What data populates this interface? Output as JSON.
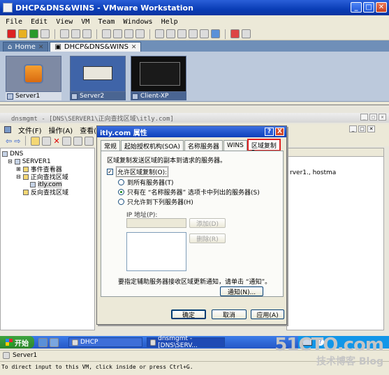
{
  "vm_window": {
    "title": "DHCP&DNS&WINS - VMware Workstation",
    "menu": [
      "File",
      "Edit",
      "View",
      "VM",
      "Team",
      "Windows",
      "Help"
    ],
    "tabs": [
      {
        "label": "Home"
      },
      {
        "label": "DHCP&DNS&WINS"
      }
    ],
    "thumbnails": [
      {
        "label": "Server1"
      },
      {
        "label": "Server2"
      },
      {
        "label": "Client-XP"
      }
    ],
    "status_vm": "Server1",
    "hint": "To direct input to this VM, click inside or press Ctrl+G."
  },
  "mmc": {
    "title": "dnsmgmt - [DNS\\SERVER1\\正向查找区域\\itly.com]",
    "menu": [
      "文件(F)",
      "操作(A)",
      "查看(V)"
    ],
    "tree": [
      {
        "label": "DNS"
      },
      {
        "label": "SERVER1"
      },
      {
        "label": "事件查看器"
      },
      {
        "label": "正向查找区域"
      },
      {
        "label": "itly.com"
      },
      {
        "label": "反向查找区域"
      }
    ],
    "right_cell": "rver1., hostma"
  },
  "dialog": {
    "title": "itly.com 属性",
    "help_btn": "?",
    "close_btn": "X",
    "tabs": [
      "常规",
      "起始授权机构(SOA)",
      "名称服务器",
      "WINS",
      "区域复制"
    ],
    "active_tab": "区域复制",
    "description": "区域复制发送区域的副本到请求的服务器。",
    "allow_transfer_label": "允许区域复制(O):",
    "allow_transfer_checked": true,
    "options": [
      {
        "label": "到所有服务器(T)",
        "selected": false
      },
      {
        "label": "只有在 “名称服务器” 选项卡中列出的服务器(S)",
        "selected": true
      },
      {
        "label": "只允许到下列服务器(H)",
        "selected": false
      }
    ],
    "ip_label": "IP 地址(P):",
    "add_button": "添加(D)",
    "remove_button": "删除(R)",
    "notify_text": "要指定辅助服务器接收区域更新通知，请单击 “通知”。",
    "notify_button": "通知(N)...",
    "ok_button": "确定",
    "cancel_button": "取消",
    "apply_button": "应用(A)"
  },
  "taskbar": {
    "start": "开始",
    "tasks": [
      {
        "label": "DHCP"
      },
      {
        "label": "dnsmgmt - [DNS\\SERV..."
      }
    ]
  },
  "watermark": {
    "site": "51CTO.com",
    "sub": "技术博客 Blog"
  }
}
